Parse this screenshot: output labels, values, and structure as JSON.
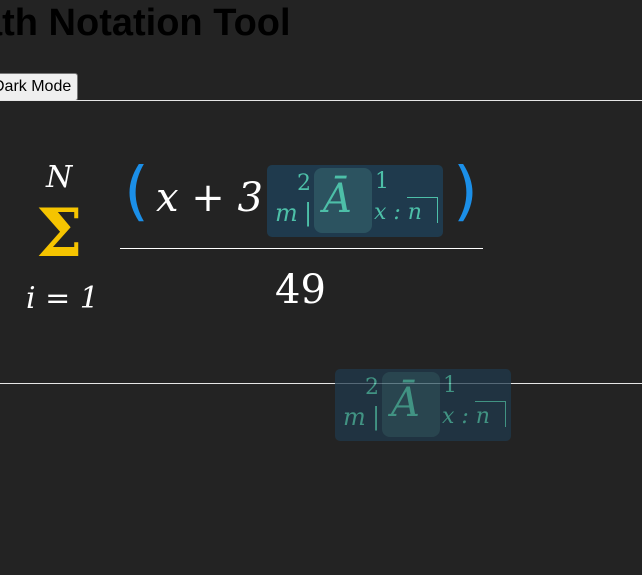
{
  "app": {
    "title": "ath Notation Tool"
  },
  "toolbar": {
    "dark_mode_label": "Dark Mode"
  },
  "formula": {
    "sum_upper": "N",
    "sum_symbol": "Σ",
    "sum_lower": "i = 1",
    "paren_open": "(",
    "paren_close": ")",
    "numerator_term": "x + 3",
    "denominator": "49",
    "actuarial": {
      "left_sub": "m",
      "left_sup": "2",
      "separator": "|",
      "main": "Ā",
      "right_sup": "1",
      "right_sub": "x : n"
    }
  },
  "drag_preview": {
    "left_sub": "m",
    "left_sup": "2",
    "separator": "|",
    "main": "Ā",
    "right_sup": "1",
    "right_sub": "x : n"
  },
  "colors": {
    "background": "#232323",
    "sum_accent": "#f5c400",
    "paren_accent": "#1b8fe8",
    "actuarial_text": "#4dbfa8",
    "actuarial_box": "#1f3a4d"
  }
}
